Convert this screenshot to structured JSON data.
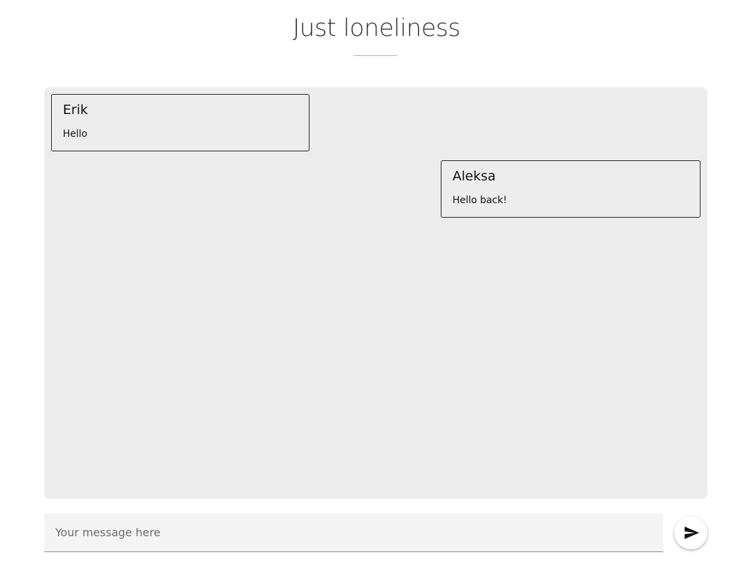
{
  "header": {
    "title": "Just loneliness"
  },
  "chat": {
    "messages": [
      {
        "author": "Erik",
        "text": "Hello",
        "side": "left"
      },
      {
        "author": "Aleksa",
        "text": "Hello back!",
        "side": "right"
      }
    ]
  },
  "composer": {
    "placeholder": "Your message here",
    "value": ""
  },
  "send_button": {
    "icon": "send-icon"
  },
  "colors": {
    "panel": "#ededed",
    "input_bg": "#f4f4f4",
    "accent_icon": "#111111"
  }
}
